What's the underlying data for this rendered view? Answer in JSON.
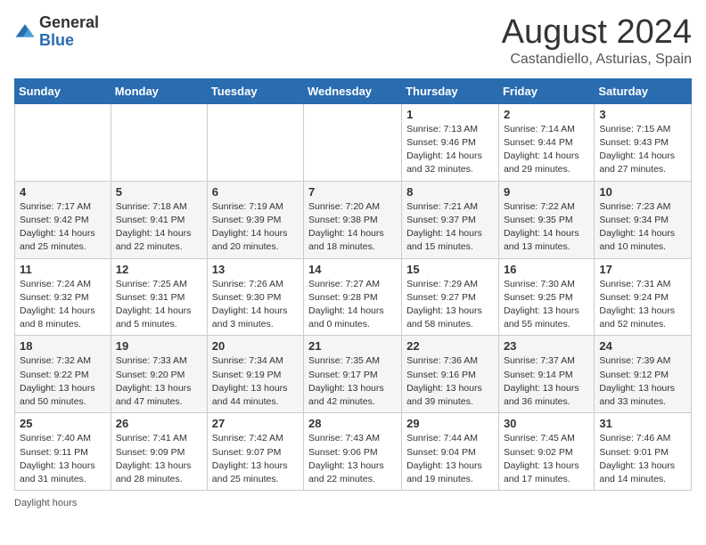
{
  "logo": {
    "general": "General",
    "blue": "Blue"
  },
  "title": "August 2024",
  "subtitle": "Castandiello, Asturias, Spain",
  "days_of_week": [
    "Sunday",
    "Monday",
    "Tuesday",
    "Wednesday",
    "Thursday",
    "Friday",
    "Saturday"
  ],
  "weeks": [
    [
      {
        "day": "",
        "info": ""
      },
      {
        "day": "",
        "info": ""
      },
      {
        "day": "",
        "info": ""
      },
      {
        "day": "",
        "info": ""
      },
      {
        "day": "1",
        "info": "Sunrise: 7:13 AM\nSunset: 9:46 PM\nDaylight: 14 hours and 32 minutes."
      },
      {
        "day": "2",
        "info": "Sunrise: 7:14 AM\nSunset: 9:44 PM\nDaylight: 14 hours and 29 minutes."
      },
      {
        "day": "3",
        "info": "Sunrise: 7:15 AM\nSunset: 9:43 PM\nDaylight: 14 hours and 27 minutes."
      }
    ],
    [
      {
        "day": "4",
        "info": "Sunrise: 7:17 AM\nSunset: 9:42 PM\nDaylight: 14 hours and 25 minutes."
      },
      {
        "day": "5",
        "info": "Sunrise: 7:18 AM\nSunset: 9:41 PM\nDaylight: 14 hours and 22 minutes."
      },
      {
        "day": "6",
        "info": "Sunrise: 7:19 AM\nSunset: 9:39 PM\nDaylight: 14 hours and 20 minutes."
      },
      {
        "day": "7",
        "info": "Sunrise: 7:20 AM\nSunset: 9:38 PM\nDaylight: 14 hours and 18 minutes."
      },
      {
        "day": "8",
        "info": "Sunrise: 7:21 AM\nSunset: 9:37 PM\nDaylight: 14 hours and 15 minutes."
      },
      {
        "day": "9",
        "info": "Sunrise: 7:22 AM\nSunset: 9:35 PM\nDaylight: 14 hours and 13 minutes."
      },
      {
        "day": "10",
        "info": "Sunrise: 7:23 AM\nSunset: 9:34 PM\nDaylight: 14 hours and 10 minutes."
      }
    ],
    [
      {
        "day": "11",
        "info": "Sunrise: 7:24 AM\nSunset: 9:32 PM\nDaylight: 14 hours and 8 minutes."
      },
      {
        "day": "12",
        "info": "Sunrise: 7:25 AM\nSunset: 9:31 PM\nDaylight: 14 hours and 5 minutes."
      },
      {
        "day": "13",
        "info": "Sunrise: 7:26 AM\nSunset: 9:30 PM\nDaylight: 14 hours and 3 minutes."
      },
      {
        "day": "14",
        "info": "Sunrise: 7:27 AM\nSunset: 9:28 PM\nDaylight: 14 hours and 0 minutes."
      },
      {
        "day": "15",
        "info": "Sunrise: 7:29 AM\nSunset: 9:27 PM\nDaylight: 13 hours and 58 minutes."
      },
      {
        "day": "16",
        "info": "Sunrise: 7:30 AM\nSunset: 9:25 PM\nDaylight: 13 hours and 55 minutes."
      },
      {
        "day": "17",
        "info": "Sunrise: 7:31 AM\nSunset: 9:24 PM\nDaylight: 13 hours and 52 minutes."
      }
    ],
    [
      {
        "day": "18",
        "info": "Sunrise: 7:32 AM\nSunset: 9:22 PM\nDaylight: 13 hours and 50 minutes."
      },
      {
        "day": "19",
        "info": "Sunrise: 7:33 AM\nSunset: 9:20 PM\nDaylight: 13 hours and 47 minutes."
      },
      {
        "day": "20",
        "info": "Sunrise: 7:34 AM\nSunset: 9:19 PM\nDaylight: 13 hours and 44 minutes."
      },
      {
        "day": "21",
        "info": "Sunrise: 7:35 AM\nSunset: 9:17 PM\nDaylight: 13 hours and 42 minutes."
      },
      {
        "day": "22",
        "info": "Sunrise: 7:36 AM\nSunset: 9:16 PM\nDaylight: 13 hours and 39 minutes."
      },
      {
        "day": "23",
        "info": "Sunrise: 7:37 AM\nSunset: 9:14 PM\nDaylight: 13 hours and 36 minutes."
      },
      {
        "day": "24",
        "info": "Sunrise: 7:39 AM\nSunset: 9:12 PM\nDaylight: 13 hours and 33 minutes."
      }
    ],
    [
      {
        "day": "25",
        "info": "Sunrise: 7:40 AM\nSunset: 9:11 PM\nDaylight: 13 hours and 31 minutes."
      },
      {
        "day": "26",
        "info": "Sunrise: 7:41 AM\nSunset: 9:09 PM\nDaylight: 13 hours and 28 minutes."
      },
      {
        "day": "27",
        "info": "Sunrise: 7:42 AM\nSunset: 9:07 PM\nDaylight: 13 hours and 25 minutes."
      },
      {
        "day": "28",
        "info": "Sunrise: 7:43 AM\nSunset: 9:06 PM\nDaylight: 13 hours and 22 minutes."
      },
      {
        "day": "29",
        "info": "Sunrise: 7:44 AM\nSunset: 9:04 PM\nDaylight: 13 hours and 19 minutes."
      },
      {
        "day": "30",
        "info": "Sunrise: 7:45 AM\nSunset: 9:02 PM\nDaylight: 13 hours and 17 minutes."
      },
      {
        "day": "31",
        "info": "Sunrise: 7:46 AM\nSunset: 9:01 PM\nDaylight: 13 hours and 14 minutes."
      }
    ]
  ],
  "footer": "Daylight hours"
}
